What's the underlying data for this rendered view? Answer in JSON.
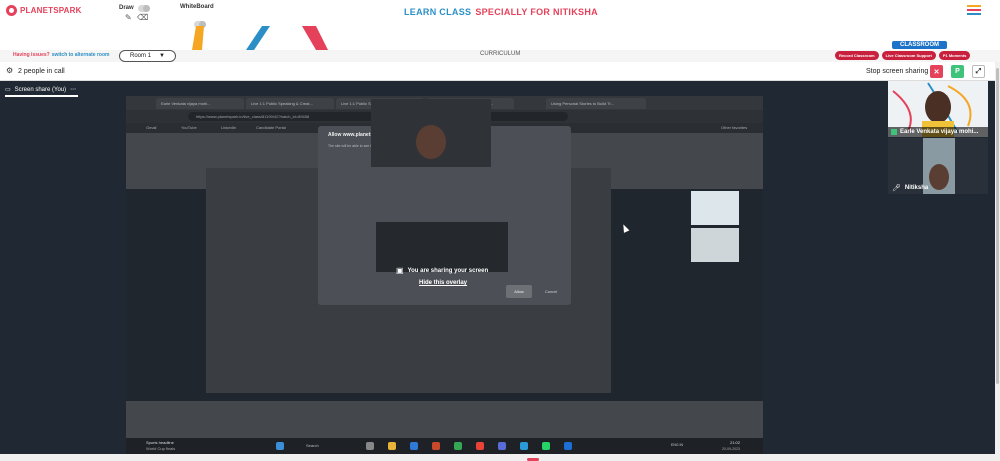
{
  "header": {
    "logo_text": "PLANETSPARK",
    "draw_label": "Draw",
    "whiteboard_label": "WhiteBoard",
    "title_prefix": "LEARN CLASS",
    "title_suffix": "SPECIALLY FOR NITIKSHA"
  },
  "banner": {
    "issue_text": "Having issues?",
    "issue_link": "switch to alternate room",
    "room_label": "Room 1",
    "curriculum_label": "CURRICULUM",
    "classroom_label": "CLASSROOM",
    "pills": [
      "Record Classroom",
      "Live Classroom Support",
      "P1 Moments"
    ]
  },
  "callbar": {
    "people_text": "2 people in call",
    "stop_text": "Stop screen sharing",
    "p_badge": "P"
  },
  "main": {
    "tab_label": "Screen share (You)"
  },
  "shared_screen": {
    "browser_tabs": [
      "Earle Venkata vijaya mohi...",
      "Live 1:1 Public Speaking & Creat...",
      "Live 1:1 Public Speaking & Creat...",
      "Live 1:1 Public Speaking & Creat...",
      "Using Personal Stories to Build Tr..."
    ],
    "url": "https://www.planetspark.in/live_class/81190/42?batch_id=89458",
    "bookmarks": [
      "Gmail",
      "YouTube",
      "LinkedIn",
      "Candidate Portal",
      "Other favorites"
    ],
    "overlay_title": "Allow www.planetspark.in to see your screen?",
    "overlay_sub": "The site will be able to see the contents of your screen.",
    "share_msg": "You are sharing your screen",
    "hide_overlay": "Hide this overlay",
    "allow_label": "Allow",
    "cancel_label": "Cancel",
    "taskbar_left": "Sports headline",
    "taskbar_left_sub": "World Cup finals",
    "taskbar_search": "Search",
    "clock_time": "21:02",
    "clock_date": "20-09-2023",
    "tray_lang": "ENG IN"
  },
  "sidebar": {
    "participants": [
      {
        "name": "Earle Venkata vijaya mohi..."
      },
      {
        "name": "Nitiksha"
      }
    ]
  },
  "colors": {
    "brand_red": "#e5415a",
    "brand_blue": "#2b8fc6",
    "dark_bg": "#1f2833",
    "classroom_blue": "#1d72c9"
  }
}
